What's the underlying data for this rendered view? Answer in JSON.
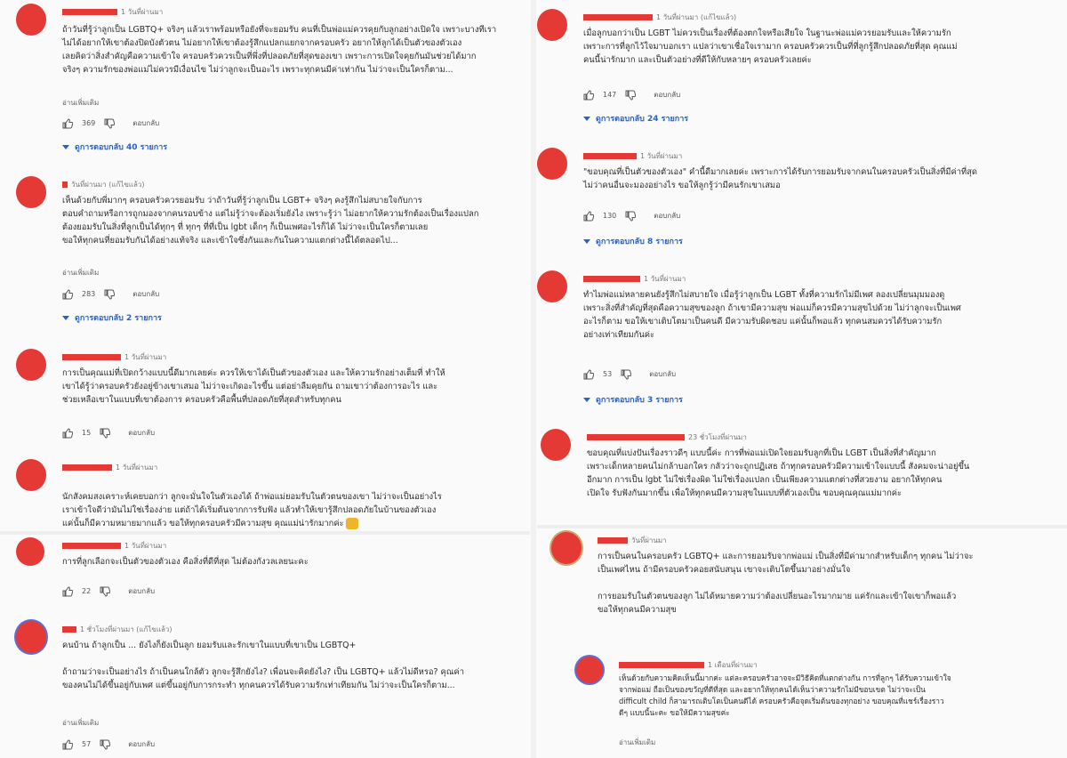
{
  "labels": {
    "reply": "ตอบกลับ",
    "show_more": "อ่านเพิ่มเติม"
  },
  "left": [
    {
      "time": "1 วันที่ผ่านมา",
      "text": "ถ้าวันที่รู้ว่าลูกเป็น LGBTQ+ จริงๆ แล้วเราพร้อมหรือยังที่จะยอมรับ คนที่เป็นพ่อแม่ควรคุยกับลูกอย่างเปิดใจ เพราะบางทีเรา\nไม่ได้อยากให้เขาต้องปิดบังตัวตน ไม่อยากให้เขาต้องรู้สึกแปลกแยกจากครอบครัว อยากให้ลูกได้เป็นตัวของตัวเอง\nเลยคิดว่าสิ่งสำคัญคือความเข้าใจ ครอบครัวควรเป็นที่พึ่งที่ปลอดภัยที่สุดของเขา เพราะการเปิดใจคุยกันมันช่วยได้มาก\nจริงๆ ความรักของพ่อแม่ไม่ควรมีเงื่อนไข ไม่ว่าลูกจะเป็นอะไร เพราะทุกคนมีค่าเท่ากัน ไม่ว่าจะเป็นใครก็ตาม...",
      "likes": "369",
      "replies": "ดูการตอบกลับ 40 รายการ"
    },
    {
      "time": "วันที่ผ่านมา (แก้ไขแล้ว)",
      "text": "เห็นด้วยกับพี่มากๆ ครอบครัวควรยอมรับ ว่าถ้าวันที่รู้ว่าลูกเป็น LGBT+ จริงๆ คงรู้สึกไม่สบายใจกับการ\nตอบคำถามหรือการถูกมองจากคนรอบข้าง แต่ไม่รู้ว่าจะต้องเริ่มยังไง เพราะรู้ว่า ไม่อยากให้ความรักต้องเป็นเรื่องแปลก\nต้องยอมรับในสิ่งที่ลูกเป็นได้ทุกๆ ที่ ทุกๆ ที่ที่เป็น lgbt เด็กๆ ก็เป็นเพศอะไรก็ได้ ไม่ว่าจะเป็นใครก็ตามเลย\nขอให้ทุกคนที่ยอมรับกันได้อย่างแท้จริง และเข้าใจซึ่งกันและกันในความแตกต่างนี้ได้ตลอดไป...",
      "likes": "283",
      "replies": "ดูการตอบกลับ 2 รายการ"
    },
    {
      "time": "1 วันที่ผ่านมา",
      "text": "การเป็นคุณแม่ที่เปิดกว้างแบบนี้ดีมากเลยค่ะ ควรให้เขาได้เป็นตัวของตัวเอง และให้ความรักอย่างเต็มที่ ทำให้\nเขาได้รู้ว่าครอบครัวยังอยู่ข้างเขาเสมอ ไม่ว่าจะเกิดอะไรขึ้น แต่อย่าลืมคุยกัน ถามเขาว่าต้องการอะไร และ\nช่วยเหลือเขาในแบบที่เขาต้องการ ครอบครัวคือพื้นที่ปลอดภัยที่สุดสำหรับทุกคน",
      "likes": "15",
      "replies": ""
    },
    {
      "time": "1 วันที่ผ่านมา",
      "text": "นักสังคมสงเคราะห์เคยบอกว่า ลูกจะมั่นใจในตัวเองได้ ถ้าพ่อแม่ยอมรับในตัวตนของเขา ไม่ว่าจะเป็นอย่างไร\nเราเข้าใจดีว่ามันไม่ใช่เรื่องง่าย แต่ถ้าได้เริ่มต้นจากการรับฟัง แล้วทำให้เขารู้สึกปลอดภัยในบ้านของตัวเอง\nแค่นั้นก็มีความหมายมากแล้ว ขอให้ทุกครอบครัวมีความสุข คุณแม่น่ารักมากค่ะ",
      "likes": "",
      "replies": ""
    },
    {
      "time": "1 วันที่ผ่านมา",
      "text": "การที่ลูกเลือกจะเป็นตัวของตัวเอง คือสิ่งที่ดีที่สุด ไม่ต้องกังวลเลยนะคะ",
      "likes": "22",
      "replies": ""
    },
    {
      "time": "1 ชั่วโมงที่ผ่านมา (แก้ไขแล้ว)",
      "text": "คนบ้าน ถ้าลูกเป็น ... ยังไงก็ยังเป็นลูก ยอมรับและรักเขาในแบบที่เขาเป็น LGBTQ+\n\nถ้าถามว่าจะเป็นอย่างไร ถ้าเป็นคนใกล้ตัว ลูกจะรู้สึกยังไง? เพื่อนจะคิดยังไง? เป็น LGBTQ+ แล้วไม่ดีหรอ? คุณค่า\nของคนไม่ได้ขึ้นอยู่กับเพศ แต่ขึ้นอยู่กับการกระทำ ทุกคนควรได้รับความรักเท่าเทียมกัน ไม่ว่าจะเป็นใครก็ตาม...",
      "likes": "57",
      "replies": ""
    }
  ],
  "right": [
    {
      "time": "1 วันที่ผ่านมา (แก้ไขแล้ว)",
      "text": "เมื่อลูกบอกว่าเป็น LGBT ไม่ควรเป็นเรื่องที่ต้องตกใจหรือเสียใจ ในฐานะพ่อแม่ควรยอมรับและให้ความรัก\nเพราะการที่ลูกไว้ใจมาบอกเรา แปลว่าเขาเชื่อใจเรามาก ครอบครัวควรเป็นที่ที่ลูกรู้สึกปลอดภัยที่สุด คุณแม่\nคนนี้น่ารักมาก และเป็นตัวอย่างที่ดีให้กับหลายๆ ครอบครัวเลยค่ะ",
      "likes": "147",
      "replies": "ดูการตอบกลับ 24 รายการ"
    },
    {
      "time": "1 วันที่ผ่านมา",
      "text": "\"ขอบคุณที่เป็นตัวของตัวเอง\" คำนี้ดีมากเลยค่ะ เพราะการได้รับการยอมรับจากคนในครอบครัวเป็นสิ่งที่มีค่าที่สุด\nไม่ว่าคนอื่นจะมองอย่างไร ขอให้ลูกรู้ว่ามีคนรักเขาเสมอ",
      "likes": "130",
      "replies": "ดูการตอบกลับ 8 รายการ"
    },
    {
      "time": "1 วันที่ผ่านมา",
      "text": "ทำไมพ่อแม่หลายคนยังรู้สึกไม่สบายใจ เมื่อรู้ว่าลูกเป็น LGBT ทั้งที่ความรักไม่มีเพศ ลองเปลี่ยนมุมมองดู\nเพราะสิ่งที่สำคัญที่สุดคือความสุขของลูก ถ้าเขามีความสุข พ่อแม่ก็ควรมีความสุขไปด้วย ไม่ว่าลูกจะเป็นเพศ\nอะไรก็ตาม ขอให้เขาเติบโตมาเป็นคนดี มีความรับผิดชอบ แค่นั้นก็พอแล้ว ทุกคนสมควรได้รับความรัก\nอย่างเท่าเทียมกันค่ะ",
      "likes": "53",
      "replies": "ดูการตอบกลับ 3 รายการ"
    },
    {
      "time": "23 ชั่วโมงที่ผ่านมา",
      "text": "ขอบคุณที่แบ่งปันเรื่องราวดีๆ แบบนี้ค่ะ การที่พ่อแม่เปิดใจยอมรับลูกที่เป็น LGBT เป็นสิ่งที่สำคัญมาก\nเพราะเด็กหลายคนไม่กล้าบอกใคร กลัวว่าจะถูกปฏิเสธ ถ้าทุกครอบครัวมีความเข้าใจแบบนี้ สังคมจะน่าอยู่ขึ้น\nอีกมาก การเป็น lgbt ไม่ใช่เรื่องผิด ไม่ใช่เรื่องแปลก เป็นเพียงความแตกต่างที่สวยงาม อยากให้ทุกคน\nเปิดใจ รับฟังกันมากขึ้น เพื่อให้ทุกคนมีความสุขในแบบที่ตัวเองเป็น ขอบคุณคุณแม่มากค่ะ",
      "likes": "",
      "replies": ""
    },
    {
      "time": "วันที่ผ่านมา",
      "text": "การเป็นคนในครอบครัว LGBTQ+ และการยอมรับจากพ่อแม่ เป็นสิ่งที่มีค่ามากสำหรับเด็กๆ ทุกคน ไม่ว่าจะ\nเป็นเพศไหน ถ้ามีครอบครัวคอยสนับสนุน เขาจะเติบโตขึ้นมาอย่างมั่นใจ\n\nการยอมรับในตัวตนของลูก ไม่ได้หมายความว่าต้องเปลี่ยนอะไรมากมาย แค่รักและเข้าใจเขาก็พอแล้ว\nขอให้ทุกคนมีความสุข",
      "likes": "",
      "replies": ""
    },
    {
      "time": "1 เดือนที่ผ่านมา",
      "text": "เห็นด้วยกับความคิดเห็นนี้มากค่ะ แต่ละครอบครัวอาจจะมีวิธีคิดที่แตกต่างกัน การที่ลูกๆ ได้รับความเข้าใจ\nจากพ่อแม่ ถือเป็นของขวัญที่ดีที่สุด และอยากให้ทุกคนได้เห็นว่าความรักไม่มีขอบเขต ไม่ว่าจะเป็น\ndifficult child ก็สามารถเติบโตเป็นคนดีได้ ครอบครัวคือจุดเริ่มต้นของทุกอย่าง ขอบคุณที่แชร์เรื่องราว\nดีๆ แบบนี้นะคะ ขอให้มีความสุขค่ะ",
      "likes": "",
      "replies": ""
    }
  ]
}
